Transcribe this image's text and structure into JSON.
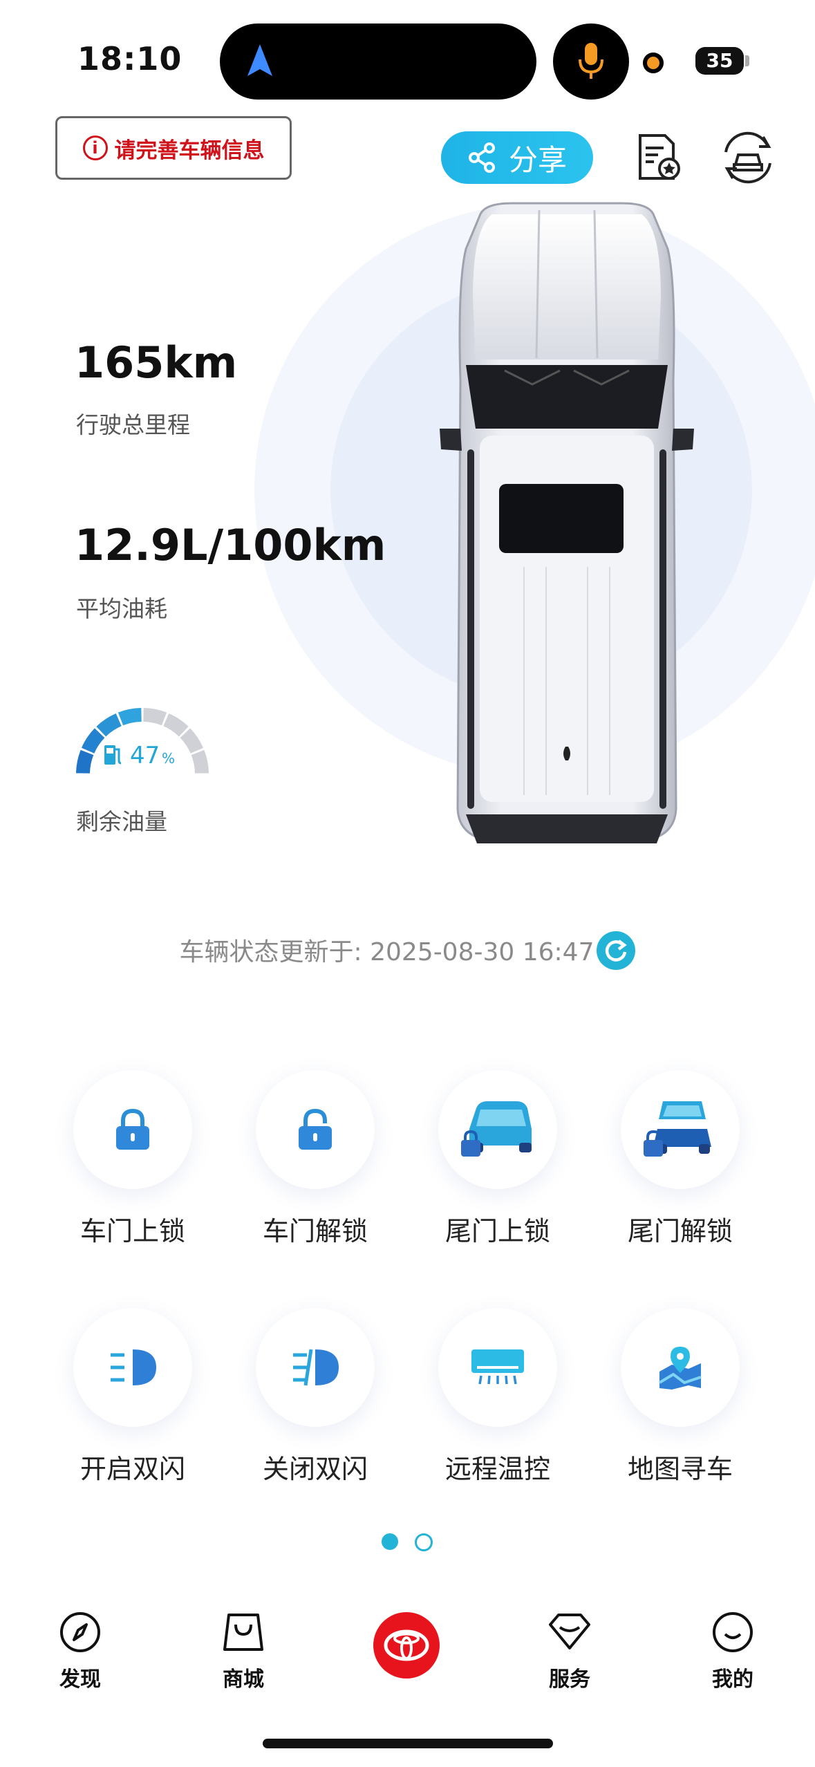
{
  "status": {
    "time": "18:10",
    "battery": "35"
  },
  "header": {
    "complete_info": "请完善车辆信息",
    "share_label": "分享"
  },
  "stats": {
    "mileage_value": "165km",
    "mileage_label": "行驶总里程",
    "fuel_consumption_value": "12.9L/100km",
    "fuel_consumption_label": "平均油耗",
    "fuel_level_percent": 47,
    "fuel_level_number": "47",
    "fuel_level_unit": "%",
    "fuel_level_label": "剩余油量"
  },
  "update": {
    "text": "车辆状态更新于: 2025-08-30 16:47"
  },
  "controls": [
    {
      "label": "车门上锁",
      "icon": "lock-closed-icon"
    },
    {
      "label": "车门解锁",
      "icon": "lock-open-icon"
    },
    {
      "label": "尾门上锁",
      "icon": "tailgate-lock-icon"
    },
    {
      "label": "尾门解锁",
      "icon": "tailgate-unlock-icon"
    },
    {
      "label": "开启双闪",
      "icon": "hazard-on-icon"
    },
    {
      "label": "关闭双闪",
      "icon": "hazard-off-icon"
    },
    {
      "label": "远程温控",
      "icon": "air-conditioner-icon"
    },
    {
      "label": "地图寻车",
      "icon": "map-pin-icon"
    }
  ],
  "pager": {
    "current": 1,
    "total": 2
  },
  "tabs": [
    {
      "label": "发现",
      "icon": "compass-icon"
    },
    {
      "label": "商城",
      "icon": "shopping-bag-icon"
    },
    {
      "label": "",
      "icon": "toyota-logo-icon"
    },
    {
      "label": "服务",
      "icon": "diamond-icon"
    },
    {
      "label": "我的",
      "icon": "smile-face-icon"
    }
  ],
  "colors": {
    "accent": "#22b3d6",
    "brand_red": "#e8141d",
    "warning_red": "#d0121b",
    "mic_orange": "#f59a23"
  }
}
